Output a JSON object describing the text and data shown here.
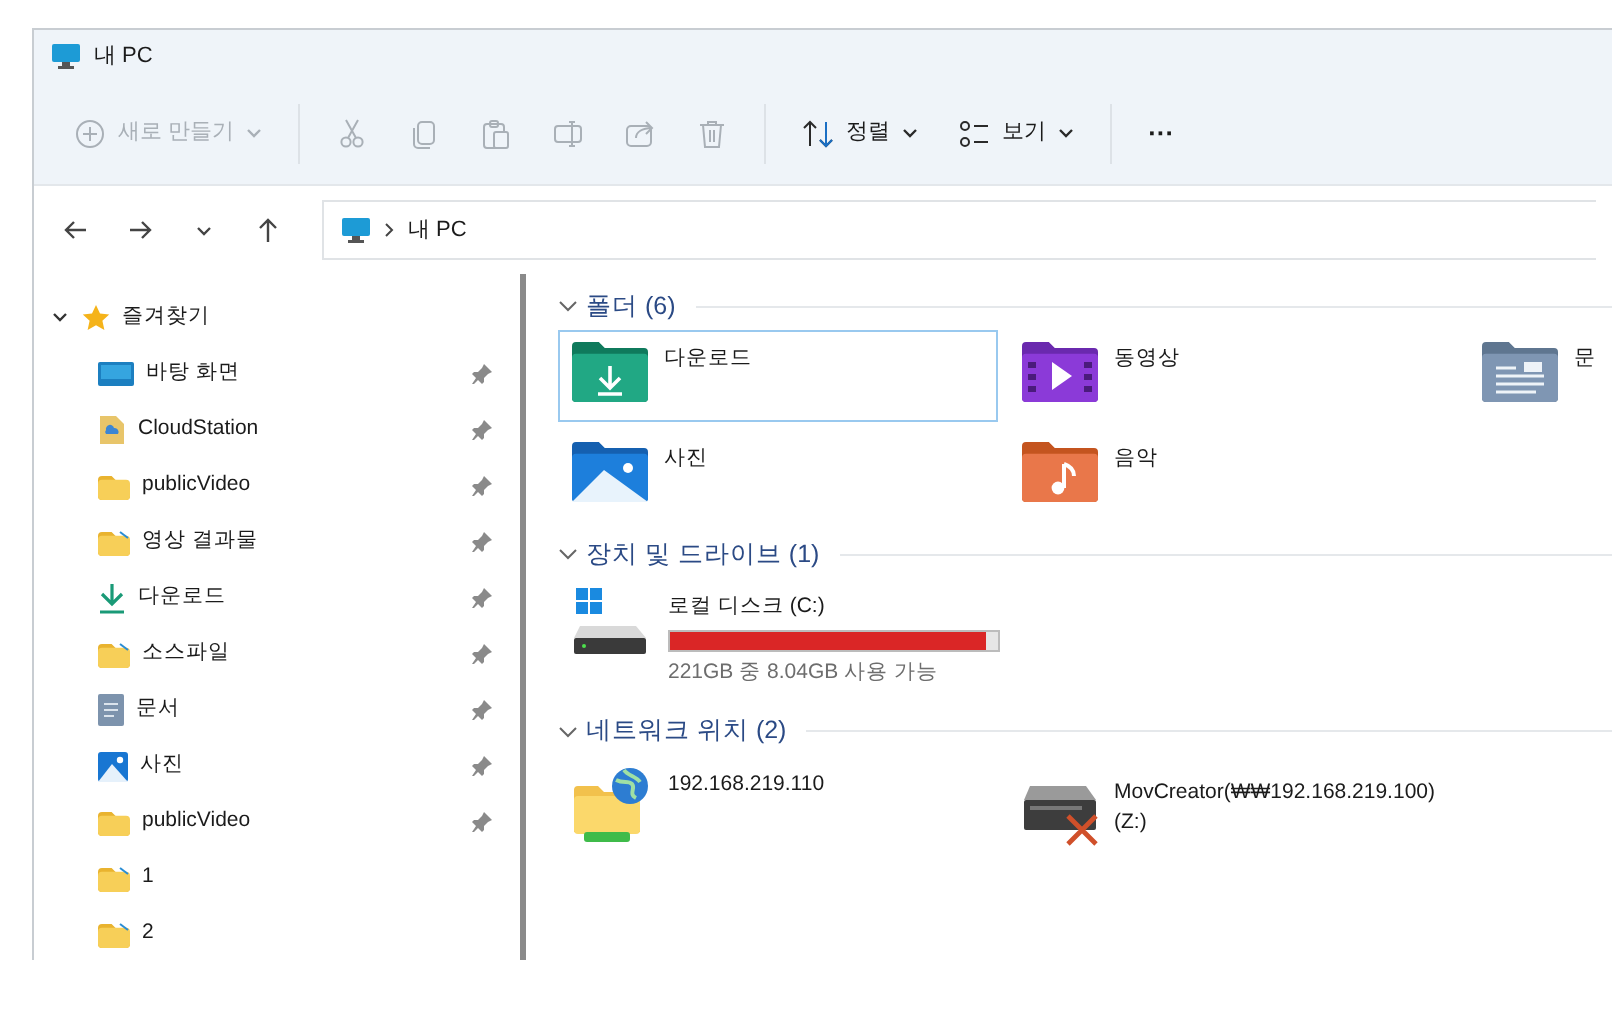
{
  "window": {
    "title": "내 PC"
  },
  "toolbar": [
    {
      "kind": "new",
      "label": "새로 만들기",
      "dropdown": true,
      "disabled": true
    },
    {
      "kind": "cut",
      "disabled": true
    },
    {
      "kind": "copy",
      "disabled": true
    },
    {
      "kind": "paste",
      "disabled": true
    },
    {
      "kind": "rename",
      "disabled": true
    },
    {
      "kind": "share",
      "disabled": true
    },
    {
      "kind": "delete",
      "disabled": true
    },
    {
      "kind": "sort",
      "label": "정렬",
      "dropdown": true,
      "disabled": false
    },
    {
      "kind": "view",
      "label": "보기",
      "dropdown": true,
      "disabled": false
    },
    {
      "kind": "more",
      "label": "···",
      "disabled": false
    }
  ],
  "address_bar": {
    "path": [
      "내 PC"
    ]
  },
  "sidebar": {
    "sections": [
      {
        "label": "즐겨찾기",
        "expanded": true,
        "children": [
          {
            "kind": "desktop",
            "label": "바탕 화면",
            "pinned": true
          },
          {
            "kind": "cloud",
            "label": "CloudStation",
            "pinned": true
          },
          {
            "kind": "folder",
            "label": "publicVideo",
            "pinned": true
          },
          {
            "kind": "shortcut",
            "label": "영상 결과물",
            "pinned": true
          },
          {
            "kind": "download",
            "label": "다운로드",
            "pinned": true
          },
          {
            "kind": "shortcut",
            "label": "소스파일",
            "pinned": true
          },
          {
            "kind": "documents",
            "label": "문서",
            "pinned": true
          },
          {
            "kind": "pictures",
            "label": "사진",
            "pinned": true
          },
          {
            "kind": "folder",
            "label": "publicVideo",
            "pinned": true
          },
          {
            "kind": "shortcut",
            "label": "1",
            "pinned": false
          },
          {
            "kind": "shortcut",
            "label": "2",
            "pinned": false
          }
        ]
      }
    ]
  },
  "groups": [
    {
      "kind": "folders",
      "title": "폴더 (6)",
      "expanded": true,
      "items": [
        {
          "kind": "download",
          "name": "다운로드",
          "selected": true
        },
        {
          "kind": "videos",
          "name": "동영상",
          "selected": false
        },
        {
          "kind": "documents",
          "name": "문",
          "selected": false
        },
        {
          "kind": "pictures",
          "name": "사진",
          "selected": false
        },
        {
          "kind": "music",
          "name": "음악",
          "selected": false
        }
      ]
    },
    {
      "kind": "drives",
      "title": "장치 및 드라이브 (1)",
      "expanded": true,
      "items": [
        {
          "kind": "disk",
          "name": "로컬 디스크 (C:)",
          "level": 0.964,
          "detail": "221GB 중 8.04GB 사용 가능"
        }
      ]
    },
    {
      "kind": "network",
      "title": "네트워크 위치 (2)",
      "expanded": true,
      "items": [
        {
          "kind": "netfolder",
          "name": "192.168.219.110"
        },
        {
          "kind": "netdrive",
          "name": "MovCreator(₩₩192.168.219.100)",
          "detail": "(Z:)",
          "disconnected": true
        }
      ]
    }
  ]
}
